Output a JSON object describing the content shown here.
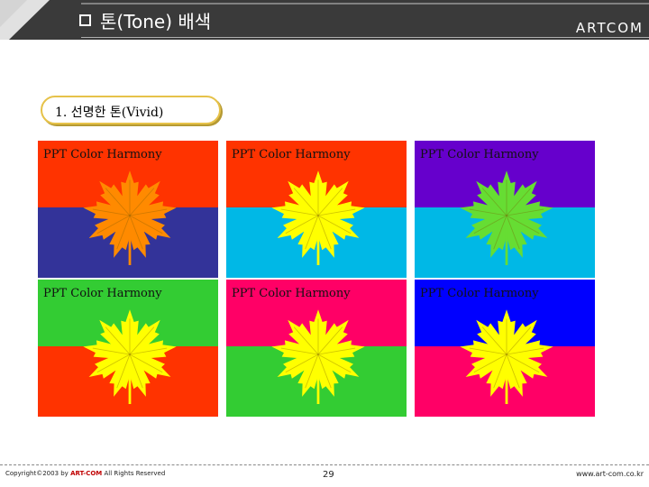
{
  "header": {
    "title": "톤(Tone) 배색",
    "brand": "ARTCOM",
    "bullet_icon": "square-bullet-icon"
  },
  "section": {
    "label": "1. 선명한 톤(Vivid)"
  },
  "panels": [
    {
      "caption": "PPT Color Harmony",
      "top_color": "#ff3300",
      "bottom_color": "#333399",
      "leaf_color": "#ff8a00"
    },
    {
      "caption": "PPT Color Harmony",
      "top_color": "#ff3300",
      "bottom_color": "#00b8e6",
      "leaf_color": "#ffff00"
    },
    {
      "caption": "PPT Color Harmony",
      "top_color": "#6600cc",
      "bottom_color": "#00b8e6",
      "leaf_color": "#66dd33"
    },
    {
      "caption": "PPT Color Harmony",
      "top_color": "#33cc33",
      "bottom_color": "#ff3300",
      "leaf_color": "#ffff00"
    },
    {
      "caption": "PPT Color Harmony",
      "top_color": "#ff0066",
      "bottom_color": "#33cc33",
      "leaf_color": "#ffff00"
    },
    {
      "caption": "PPT Color Harmony",
      "top_color": "#0000ff",
      "bottom_color": "#ff0066",
      "leaf_color": "#ffff00"
    }
  ],
  "footer": {
    "copyright_prefix": "Copyright©2003 by ",
    "copyright_brand": "ART-COM",
    "copyright_suffix": " All Rights Reserved",
    "page_number": "29",
    "website": "www.art-com.co.kr"
  }
}
